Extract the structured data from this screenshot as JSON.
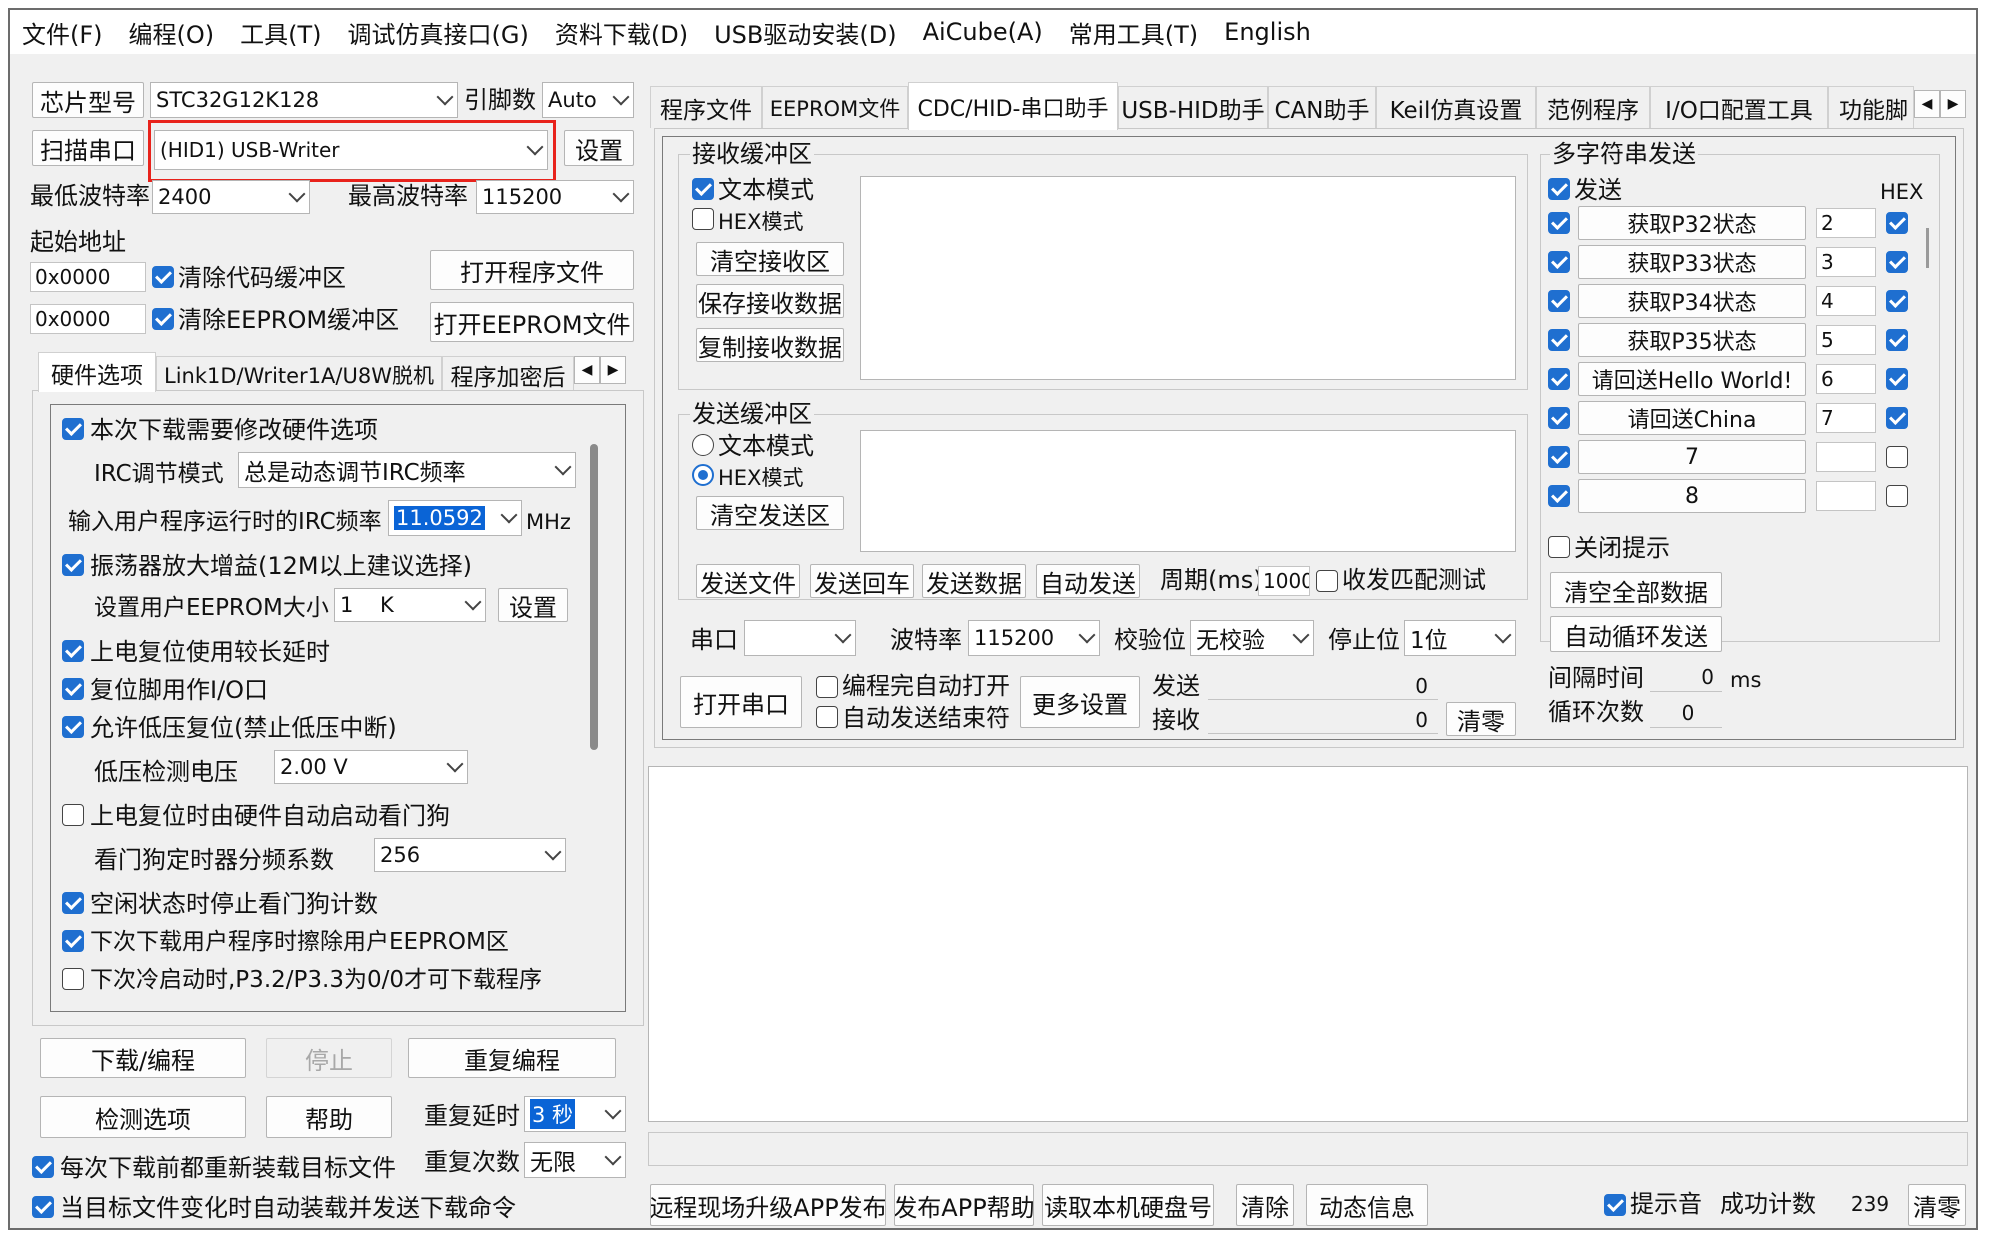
{
  "menu": [
    "文件(F)",
    "编程(O)",
    "工具(T)",
    "调试仿真接口(G)",
    "资料下载(D)",
    "USB驱动安装(D)",
    "AiCube(A)",
    "常用工具(T)",
    "English"
  ],
  "left": {
    "chip_label": "芯片型号",
    "chip_value": "STC32G12K128",
    "pins_label": "引脚数",
    "pins_value": "Auto",
    "scan_button": "扫描串口",
    "port_value": "(HID1) USB-Writer",
    "settings_button": "设置",
    "min_baud_label": "最低波特率",
    "min_baud_value": "2400",
    "max_baud_label": "最高波特率",
    "max_baud_value": "115200",
    "start_addr_label": "起始地址",
    "addr1": "0x0000",
    "clear_code_label": "清除代码缓冲区",
    "open_program_button": "打开程序文件",
    "addr2": "0x0000",
    "clear_eeprom_label": "清除EEPROM缓冲区",
    "open_eeprom_button": "打开EEPROM文件",
    "tabs": [
      "硬件选项",
      "Link1D/Writer1A/U8W脱机",
      "程序加密后"
    ],
    "hw": {
      "modify_label": "本次下载需要修改硬件选项",
      "irc_mode_label": "IRC调节模式",
      "irc_mode_value": "总是动态调节IRC频率",
      "irc_freq_label": "输入用户程序运行时的IRC频率",
      "irc_freq_value": "11.0592",
      "irc_unit": "MHz",
      "osc_label": "振荡器放大增益(12M以上建议选择)",
      "eeprom_size_label": "设置用户EEPROM大小",
      "eeprom_size_value": "1    K",
      "eeprom_set_button": "设置",
      "long_delay_label": "上电复位使用较长延时",
      "reset_io_label": "复位脚用作I/O口",
      "lvr_label": "允许低压复位(禁止低压中断)",
      "lvd_label": "低压检测电压",
      "lvd_value": "2.00 V",
      "wdt_auto_label": "上电复位时由硬件自动启动看门狗",
      "wdt_div_label": "看门狗定时器分频系数",
      "wdt_div_value": "256",
      "wdt_idle_label": "空闲状态时停止看门狗计数",
      "erase_eeprom_label": "下次下载用户程序时擦除用户EEPROM区",
      "p32_label": "下次冷启动时,P3.2/P3.3为0/0才可下载程序"
    },
    "download_button": "下载/编程",
    "stop_button": "停止",
    "reprogram_button": "重复编程",
    "check_button": "检测选项",
    "help_button": "帮助",
    "repeat_delay_label": "重复延时",
    "repeat_delay_value": "3 秒",
    "repeat_count_label": "重复次数",
    "repeat_count_value": "无限",
    "reload_label": "每次下载前都重新装载目标文件",
    "auto_reload_label": "当目标文件变化时自动装载并发送下载命令"
  },
  "right_tabs": [
    "程序文件",
    "EEPROM文件",
    "CDC/HID-串口助手",
    "USB-HID助手",
    "CAN助手",
    "Keil仿真设置",
    "范例程序",
    "I/O口配置工具",
    "功能脚"
  ],
  "serial": {
    "recv_title": "接收缓冲区",
    "recv_text_mode": "文本模式",
    "recv_hex_mode": "HEX模式",
    "clear_recv": "清空接收区",
    "save_recv": "保存接收数据",
    "copy_recv": "复制接收数据",
    "send_title": "发送缓冲区",
    "send_text_mode": "文本模式",
    "send_hex_mode": "HEX模式",
    "clear_send": "清空发送区",
    "send_file": "发送文件",
    "send_enter": "发送回车",
    "send_data": "发送数据",
    "auto_send": "自动发送",
    "period_label": "周期(ms)",
    "period_value": "1000",
    "match_test": "收发匹配测试",
    "port_label": "串口",
    "port_value": "",
    "baud_label": "波特率",
    "baud_value": "115200",
    "parity_label": "校验位",
    "parity_value": "无校验",
    "stop_label": "停止位",
    "stop_value": "1位",
    "open_port": "打开串口",
    "auto_open": "编程完自动打开",
    "auto_close": "自动发送结束符",
    "more_settings": "更多设置",
    "tx_label": "发送",
    "tx_value": "0",
    "rx_label": "接收",
    "rx_value": "0",
    "clear_counts": "清零"
  },
  "multi": {
    "title": "多字符串发送",
    "send_label": "发送",
    "hex_label": "HEX",
    "rows": [
      {
        "text": "获取P32状态",
        "num": "2"
      },
      {
        "text": "获取P33状态",
        "num": "3"
      },
      {
        "text": "获取P34状态",
        "num": "4"
      },
      {
        "text": "获取P35状态",
        "num": "5"
      },
      {
        "text": "请回送Hello World!",
        "num": "6"
      },
      {
        "text": "请回送China",
        "num": "7"
      },
      {
        "text": "7",
        "num": ""
      },
      {
        "text": "8",
        "num": ""
      }
    ],
    "close_tip": "关闭提示",
    "clear_all": "清空全部数据",
    "auto_loop": "自动循环发送",
    "interval_label": "间隔时间",
    "interval_value": "0",
    "interval_unit": "ms",
    "loop_label": "循环次数",
    "loop_value": "0"
  },
  "bottom": {
    "remote_upgrade": "远程现场升级APP发布",
    "publish_help": "发布APP帮助",
    "read_disk": "读取本机硬盘号",
    "clear": "清除",
    "dynamic_info": "动态信息",
    "beep_label": "提示音",
    "success_label": "成功计数",
    "success_value": "239",
    "reset_count": "清零"
  },
  "colors": {
    "accent": "#1f6fd0",
    "highlight_border": "#e8221b"
  }
}
